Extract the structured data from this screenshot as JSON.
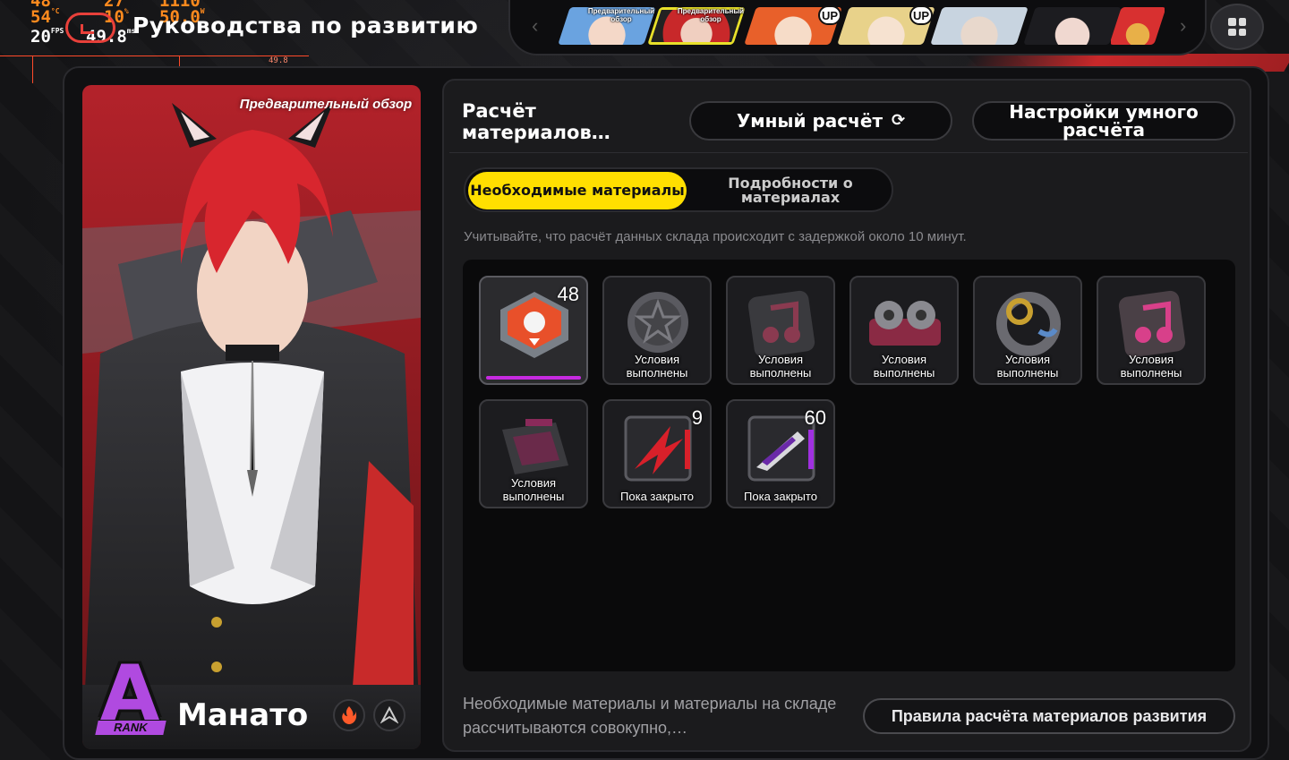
{
  "overlay": {
    "row1": [
      "48",
      "27",
      "1110"
    ],
    "temp": "54",
    "temp_unit": "°C",
    "load": "10",
    "load_unit": "%",
    "power": "50.0",
    "power_unit": "W",
    "fps": "20",
    "fps_unit": "FPS",
    "frametime": "49.8",
    "frametime_unit": "ms",
    "graph_label": "49.8 ms"
  },
  "header": {
    "title": "Руководства по развитию"
  },
  "char_bar": {
    "left_arrow": "‹",
    "right_arrow": "›",
    "characters": [
      {
        "tag": "Предварительный обзор",
        "color": "#6aa3e0"
      },
      {
        "tag": "Предварительный обзор",
        "color": "#c8282a",
        "selected": true
      },
      {
        "badge": "UP",
        "color": "#e8602a"
      },
      {
        "badge": "UP",
        "color": "#e8d28a"
      },
      {
        "color": "#c8d4e0"
      },
      {
        "color": "#2a2a2e"
      },
      {
        "color": "#d83030"
      }
    ]
  },
  "character": {
    "preview_label": "Предварительный обзор",
    "rank": "A",
    "rank_word": "RANK",
    "name": "Манато",
    "element_icon": "fire-icon",
    "specialty_icon": "attack-icon"
  },
  "panel": {
    "title": "Расчёт материалов…",
    "smart_calc_label": "Умный расчёт",
    "smart_settings_label": "Настройки умного расчёта",
    "tab_required": "Необходимые материалы",
    "tab_details": "Подробности о материалах",
    "note": "Учитывайте, что расчёт данных склада происходит с задержкой около 10 минут.",
    "footer_note": "Необходимые материалы и материалы на складе рассчитываются совокупно,…",
    "rules_label": "Правила расчёта материалов развития"
  },
  "materials": [
    {
      "count": "48",
      "status": "",
      "type": "chip-orange"
    },
    {
      "count": "",
      "status": "Условия выполнены",
      "type": "disc-grey"
    },
    {
      "count": "",
      "status": "Условия выполнены",
      "type": "note-dark"
    },
    {
      "count": "",
      "status": "Условия выполнены",
      "type": "reel-pink"
    },
    {
      "count": "",
      "status": "Условия выполнены",
      "type": "ring-gold"
    },
    {
      "count": "",
      "status": "Условия выполнены",
      "type": "note-pink"
    },
    {
      "count": "",
      "status": "Условия выполнены",
      "type": "drive-pink"
    },
    {
      "count": "9",
      "status": "Пока закрыто",
      "type": "crystal-red"
    },
    {
      "count": "60",
      "status": "Пока закрыто",
      "type": "blade-purple"
    }
  ],
  "colors": {
    "accent_yellow": "#ffdf00",
    "rank_purple": "#b04ae0",
    "card_red": "#b3222a"
  }
}
